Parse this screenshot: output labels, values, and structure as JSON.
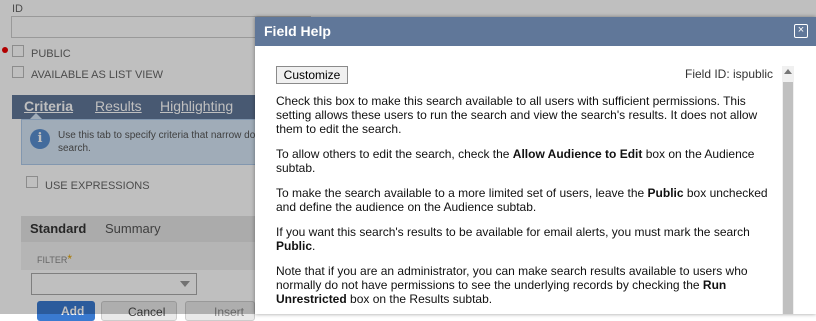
{
  "background": {
    "id_label": "ID",
    "public_label": "PUBLIC",
    "available_list_label": "AVAILABLE AS LIST VIEW",
    "tabs": [
      "Criteria",
      "Results",
      "Highlighting"
    ],
    "info_text": "Use this tab to specify criteria that narrow do search.",
    "use_expressions_label": "USE EXPRESSIONS",
    "subtabs": [
      "Standard",
      "Summary"
    ],
    "filter_label": "FILTER",
    "filter_required_marker": "*",
    "buttons": {
      "add": "Add",
      "cancel": "Cancel",
      "insert": "Insert"
    }
  },
  "dialog": {
    "title": "Field Help",
    "close_glyph": "×",
    "customize_label": "Customize",
    "field_id_text": "Field ID: ispublic",
    "paragraphs": [
      {
        "parts": [
          {
            "text": "Check this box to make this search available to all users with sufficient permissions. This setting allows these users to run the search and view the search's results. It does not allow them to edit the search."
          }
        ]
      },
      {
        "parts": [
          {
            "text": "To allow others to edit the search, check the "
          },
          {
            "text": "Allow Audience to Edit",
            "bold": true
          },
          {
            "text": " box on the Audience subtab."
          }
        ]
      },
      {
        "parts": [
          {
            "text": "To make the search available to a more limited set of users, leave the "
          },
          {
            "text": "Public",
            "bold": true
          },
          {
            "text": " box unchecked and define the audience on the Audience subtab."
          }
        ]
      },
      {
        "parts": [
          {
            "text": "If you want this search's results to be available for email alerts, you must mark the search "
          },
          {
            "text": "Public",
            "bold": true
          },
          {
            "text": "."
          }
        ]
      },
      {
        "parts": [
          {
            "text": "Note that if you are an administrator, you can make search results available to users who normally do not have permissions to see the underlying records by checking the "
          },
          {
            "text": "Run Unrestricted",
            "bold": true
          },
          {
            "text": " box on the Results subtab."
          }
        ]
      }
    ]
  },
  "colors": {
    "title_bar": "#607799",
    "info_bg": "#d6e6f6",
    "add_button": "#3a7ad0"
  }
}
